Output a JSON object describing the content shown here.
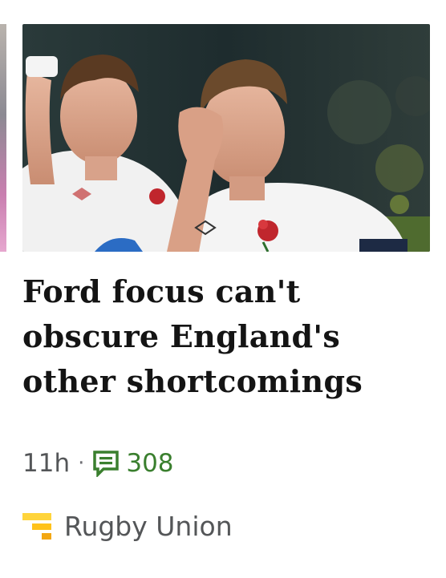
{
  "article": {
    "image_alt": "England rugby players looking dejected on the pitch",
    "headline": "Ford focus can't obscure England's other shortcomings",
    "time_ago": "11h",
    "separator": "·",
    "comment_count": "308",
    "topic": "Rugby Union"
  },
  "icons": {
    "comments": "comment-bubble-icon",
    "topic": "bbc-sport-topic-icon"
  },
  "colors": {
    "headline": "#141414",
    "meta_text": "#545658",
    "comments_accent": "#3a7f2e",
    "topic_icon_light": "#ffd43b",
    "topic_icon_dark": "#f3a712"
  }
}
